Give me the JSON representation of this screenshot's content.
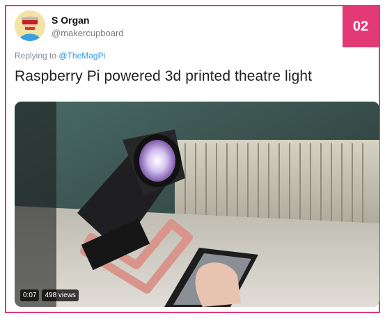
{
  "badge": "02",
  "tweet": {
    "display_name": "S Organ",
    "handle": "@makercupboard",
    "reply_prefix": "Replying to",
    "reply_to": "@TheMagPi",
    "text": "Raspberry Pi powered 3d printed theatre light"
  },
  "video": {
    "duration": "0:07",
    "views": "498 views"
  },
  "colors": {
    "accent": "#e23a74",
    "link": "#2b9bea"
  }
}
